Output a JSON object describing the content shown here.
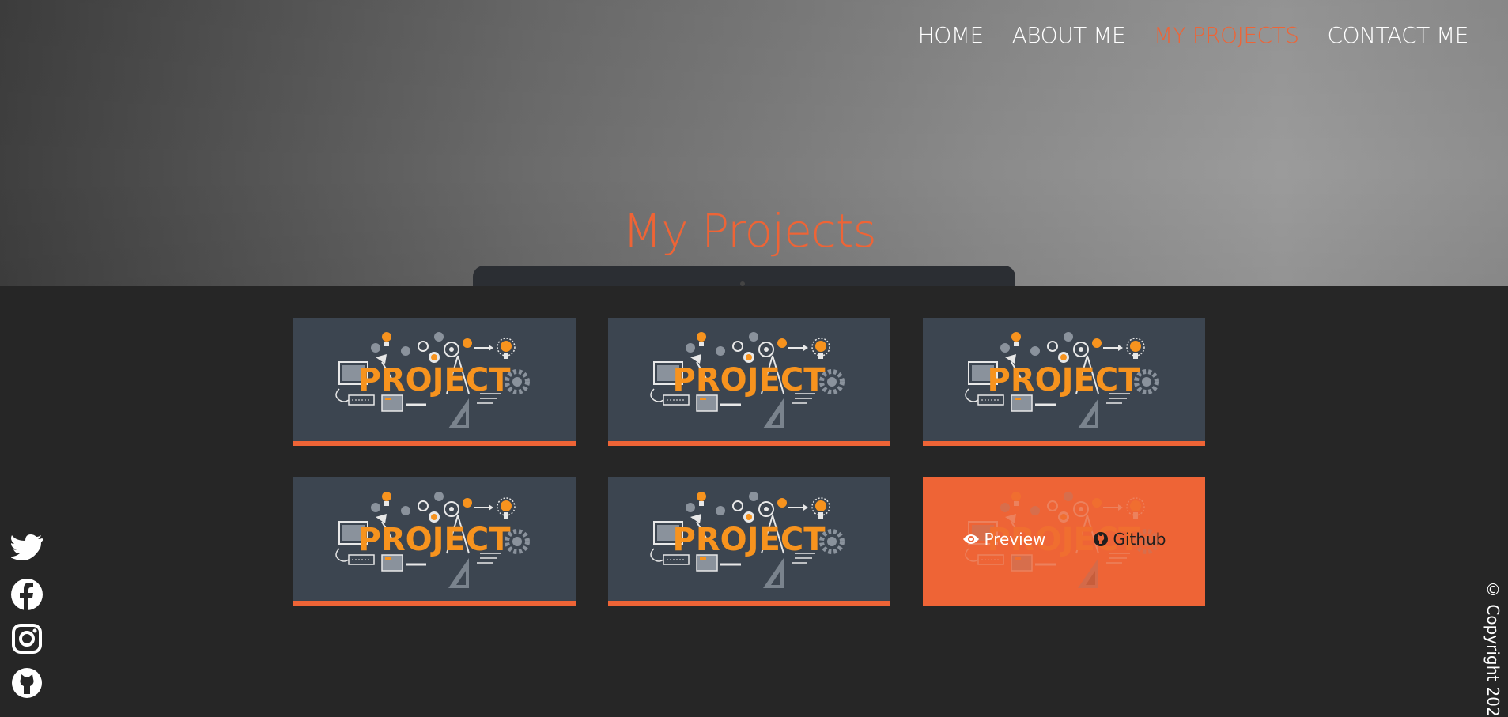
{
  "nav": {
    "items": [
      {
        "label": "HOME",
        "active": false
      },
      {
        "label": "ABOUT ME",
        "active": false
      },
      {
        "label": "MY PROJECTS",
        "active": true
      },
      {
        "label": "CONTACT ME",
        "active": false
      }
    ]
  },
  "hero": {
    "title": "My Projects"
  },
  "projects": {
    "cards": [
      {
        "image_text": "PROJECT"
      },
      {
        "image_text": "PROJECT"
      },
      {
        "image_text": "PROJECT"
      },
      {
        "image_text": "PROJECT"
      },
      {
        "image_text": "PROJECT"
      },
      {
        "image_text": "PROJECT",
        "hovered": true,
        "preview_label": "Preview",
        "github_label": "Github"
      }
    ]
  },
  "social": {
    "icons": [
      "twitter-icon",
      "facebook-icon",
      "instagram-icon",
      "github-icon"
    ]
  },
  "footer": {
    "copyright": "© Copyright 202"
  },
  "colors": {
    "accent": "#ee6436",
    "card_bg": "#3c4550",
    "page_bg": "#262626"
  }
}
